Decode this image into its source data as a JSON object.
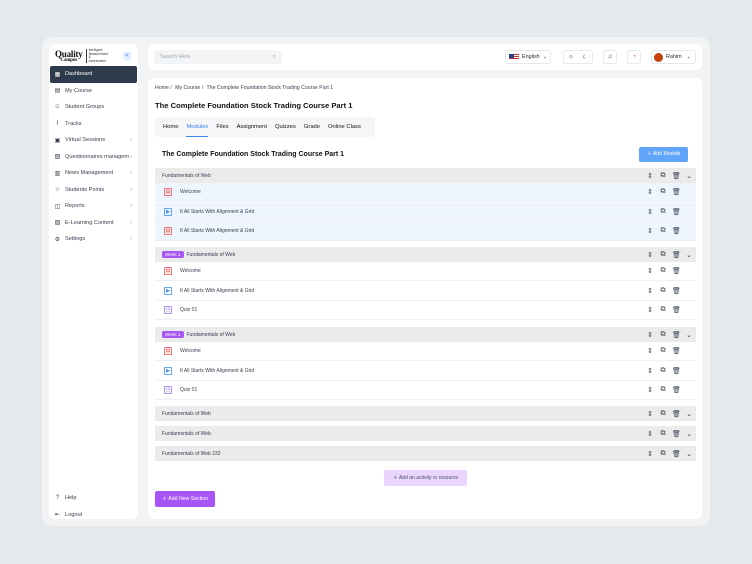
{
  "logo": {
    "word": "Quality",
    "sub": "Campus",
    "tagline": "Intelligent Measurement & Assessment"
  },
  "sidebar": {
    "items": [
      {
        "label": "Dashboard",
        "icon": "grid-icon"
      },
      {
        "label": "My Course",
        "icon": "book-icon"
      },
      {
        "label": "Student Groups",
        "icon": "users-icon"
      },
      {
        "label": "Tracks",
        "icon": "chart-icon"
      },
      {
        "label": "Virtual Sessions",
        "icon": "video-icon"
      },
      {
        "label": "Questionnaires managem",
        "icon": "clipboard-icon"
      },
      {
        "label": "News Management",
        "icon": "news-icon"
      },
      {
        "label": "Students Points",
        "icon": "star-icon"
      },
      {
        "label": "Reports",
        "icon": "report-icon"
      },
      {
        "label": "E-Learning Content",
        "icon": "content-icon"
      },
      {
        "label": "Settings",
        "icon": "gear-icon"
      }
    ],
    "bottom": [
      {
        "label": "Help",
        "icon": "help-icon"
      },
      {
        "label": "Logout",
        "icon": "logout-icon"
      }
    ]
  },
  "topbar": {
    "search_placeholder": "Search Here",
    "language": "English",
    "user": "Rahim"
  },
  "breadcrumb": [
    "Home /",
    "My Course /",
    "The Complete Foundation Stock Trading  Course Part 1"
  ],
  "page_title": "The Complete Foundation Stock Trading  Course Part 1",
  "tabs": [
    "Home",
    "Modules",
    "Files",
    "Assignment",
    "Quizzes",
    "Grade",
    "Online Class"
  ],
  "active_tab": "Modules",
  "panel": {
    "title": "The Complete Foundation Stock Trading  Course Part 1",
    "add_module": "Add Module",
    "add_activity": "Add an activity or resource",
    "add_section": "Add New Section"
  },
  "sections": [
    {
      "title": "Fundamentals of Web",
      "week": "",
      "rows": [
        {
          "type": "doc",
          "label": "Welcome"
        },
        {
          "type": "vid",
          "label": "It All Starts With Alignment & Grid"
        },
        {
          "type": "doc",
          "label": "It All Starts With Alignment & Grid"
        }
      ]
    },
    {
      "title": "Fundamentals of Web",
      "week": "Week 1",
      "rows": [
        {
          "type": "doc",
          "label": "Welcome"
        },
        {
          "type": "vid",
          "label": "It All Starts With Alignment & Grid"
        },
        {
          "type": "quiz",
          "label": "Quiz 01"
        }
      ]
    },
    {
      "title": "Fundamentals of Web",
      "week": "Week 1",
      "rows": [
        {
          "type": "doc",
          "label": "Welcome"
        },
        {
          "type": "vid",
          "label": "It All Starts With Alignment & Grid"
        },
        {
          "type": "quiz",
          "label": "Quiz 01"
        }
      ]
    },
    {
      "title": "Fundamentals of Web",
      "week": "",
      "rows": []
    },
    {
      "title": "Fundamentals of Web",
      "week": "",
      "rows": []
    },
    {
      "title": "Fundamentals of Web 232",
      "week": "",
      "rows": []
    }
  ]
}
